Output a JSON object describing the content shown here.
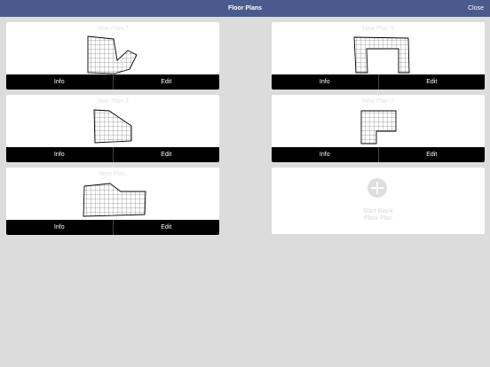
{
  "header": {
    "title": "Floor Plans",
    "close_label": "Close"
  },
  "plans": [
    {
      "name": "New Plan 7",
      "info_label": "Info",
      "edit_label": "Edit"
    },
    {
      "name": "New Plan 5",
      "info_label": "Info",
      "edit_label": "Edit"
    },
    {
      "name": "New Plan 3",
      "info_label": "Info",
      "edit_label": "Edit"
    },
    {
      "name": "New Plan 2",
      "info_label": "Info",
      "edit_label": "Edit"
    },
    {
      "name": "New Plan",
      "info_label": "Info",
      "edit_label": "Edit"
    }
  ],
  "blank_card": {
    "line1": "Start Blank",
    "line2": "Floor Plan",
    "icon": "plus-circle-icon"
  },
  "colors": {
    "header": "#4a5a8c",
    "background": "#dcdcdc",
    "bar": "#000000"
  }
}
